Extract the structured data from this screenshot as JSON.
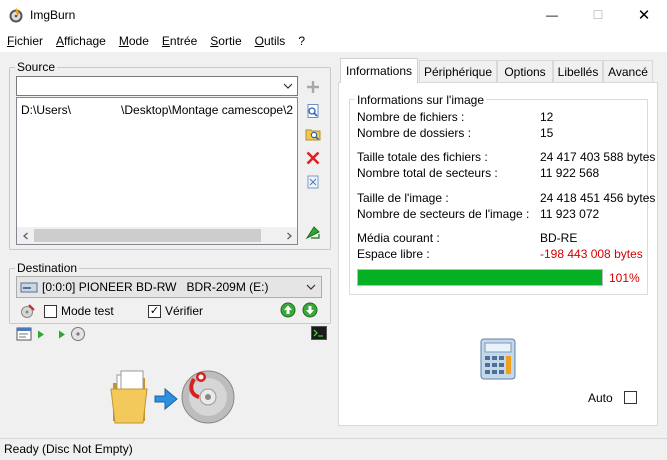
{
  "window": {
    "title": "ImgBurn",
    "min_glyph": "—",
    "max_glyph": "☐",
    "close_glyph": "✕"
  },
  "menu": [
    "Fichier",
    "Affichage",
    "Mode",
    "Entrée",
    "Sortie",
    "Outils",
    "?"
  ],
  "source": {
    "title": "Source",
    "combo_value": "",
    "path": "D:\\Users\\               \\Desktop\\Montage camescope\\2"
  },
  "destination": {
    "title": "Destination",
    "drive": "[0:0:0] PIONEER BD-RW   BDR-209M (E:)",
    "test_mode_label": "Mode test",
    "test_mode_checked": "",
    "verify_label": "Vérifier",
    "verify_checked": "✓"
  },
  "tabs": [
    "Informations",
    "Périphérique",
    "Options",
    "Libellés",
    "Avancé"
  ],
  "info": {
    "title": "Informations sur l'image",
    "rows": [
      {
        "label": "Nombre de fichiers :",
        "value": "12"
      },
      {
        "label": "Nombre de dossiers :",
        "value": "15"
      },
      {
        "label": "Taille totale des fichiers :",
        "value": "24 417 403 588 bytes"
      },
      {
        "label": "Nombre total de secteurs :",
        "value": "11 922 568"
      },
      {
        "label": "Taille de l'image :",
        "value": "24 418 451 456 bytes"
      },
      {
        "label": "Nombre de secteurs de l'image :",
        "value": "11 923 072"
      },
      {
        "label": "Média courant :",
        "value": "BD-RE"
      },
      {
        "label": "Espace libre :",
        "value": "-198 443 008 bytes"
      }
    ],
    "progress_percent": 101,
    "progress_text": "101%",
    "auto_label": "Auto"
  },
  "status": "Ready (Disc Not Empty)",
  "colors": {
    "progress": "#06b025",
    "negative": "#d40000"
  }
}
